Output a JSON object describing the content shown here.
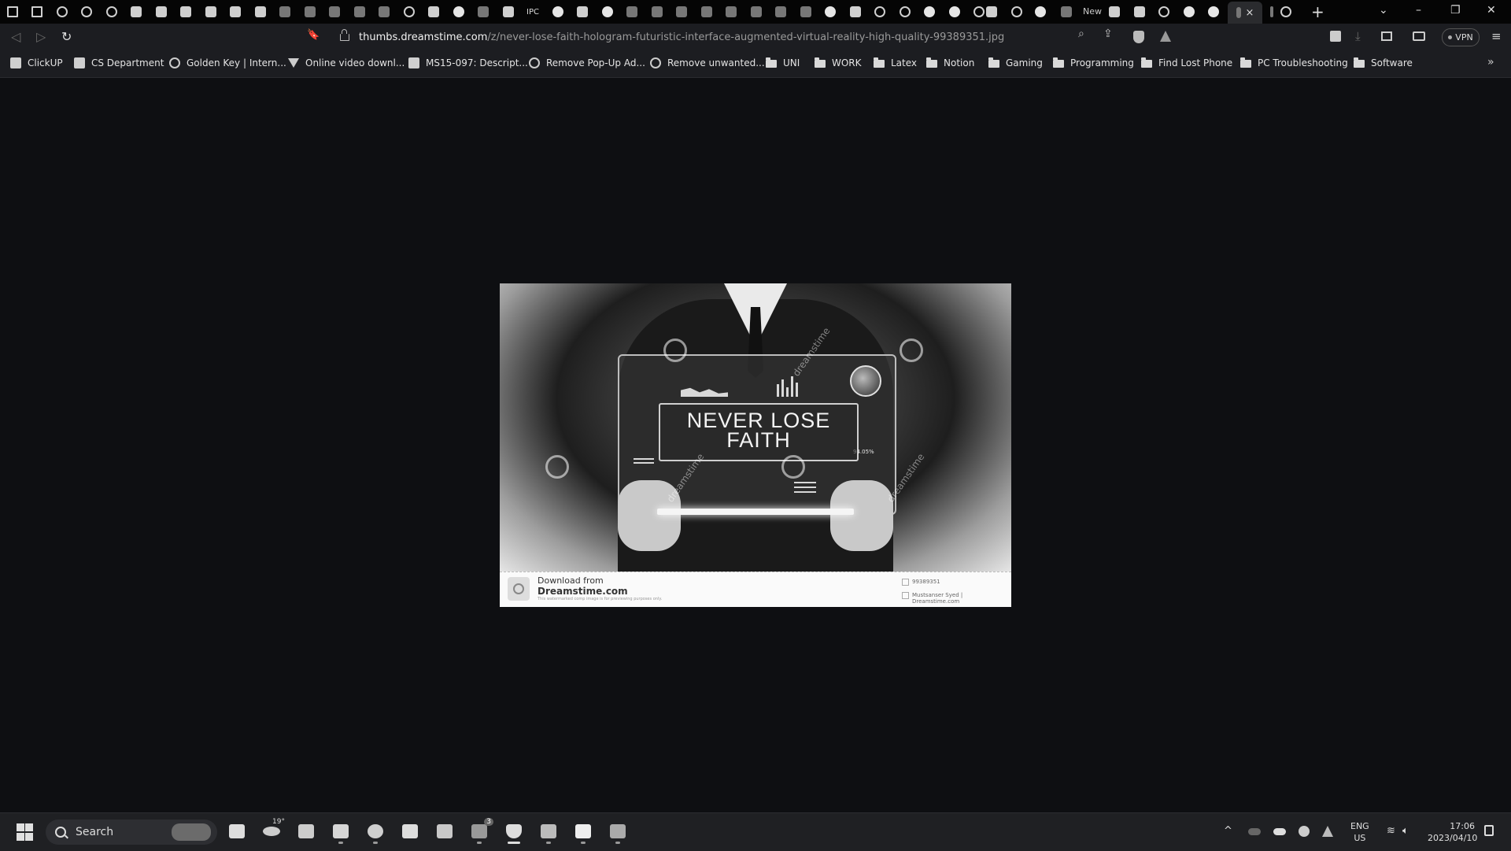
{
  "tabs": {
    "new_tab_text": "New",
    "active_close": "×",
    "new_tab_button": "+",
    "list_dropdown": "⌄",
    "minimize": "–",
    "restore": "❐",
    "close": "✕",
    "ipc_label": "IPC"
  },
  "toolbar": {
    "back_icon": "◁",
    "forward_icon": "▷",
    "reload_icon": "↻",
    "bookmark_icon": "🔖",
    "url_host": "thumbs.dreamstime.com",
    "url_path": "/z/never-lose-faith-hologram-futuristic-interface-augmented-virtual-reality-high-quality-99389351.jpg",
    "zoom_icon": "⌕",
    "share_icon": "⇪",
    "vpn_label": "VPN",
    "menu_icon": "≡"
  },
  "bookmarks": [
    {
      "label": "ClickUP",
      "icon": "clickup"
    },
    {
      "label": "CS Department",
      "icon": "doc"
    },
    {
      "label": "Golden Key | Intern...",
      "icon": "globe"
    },
    {
      "label": "Online video downl...",
      "icon": "download"
    },
    {
      "label": "MS15-097: Descript...",
      "icon": "windows"
    },
    {
      "label": "Remove Pop-Up Ad...",
      "icon": "globe"
    },
    {
      "label": "Remove unwanted...",
      "icon": "google"
    },
    {
      "label": "UNI",
      "icon": "folder"
    },
    {
      "label": "WORK",
      "icon": "folder"
    },
    {
      "label": "Latex",
      "icon": "folder"
    },
    {
      "label": "Notion",
      "icon": "folder"
    },
    {
      "label": "Gaming",
      "icon": "folder"
    },
    {
      "label": "Programming",
      "icon": "folder"
    },
    {
      "label": "Find Lost Phone",
      "icon": "folder"
    },
    {
      "label": "PC Troubleshooting",
      "icon": "folder"
    },
    {
      "label": "Software",
      "icon": "folder"
    }
  ],
  "bookmarks_more": "»",
  "image": {
    "headline_line1": "NEVER  LOSE",
    "headline_line2": "FAITH",
    "percent": "94.05%",
    "watermark": "dreamstime",
    "footer_line1": "Download from",
    "footer_line2": "Dreamstime.com",
    "footer_line3": "This watermarked comp image is for previewing purposes only.",
    "image_id": "99389351",
    "credit": "Mustsanser Syed | Dreamstime.com"
  },
  "taskbar": {
    "search_label": "Search",
    "weather_temp": "19°",
    "checklist_badge": "3",
    "tray_chevron": "^",
    "language": "ENG",
    "region": "US",
    "time": "17:06",
    "date": "2023/04/10"
  }
}
